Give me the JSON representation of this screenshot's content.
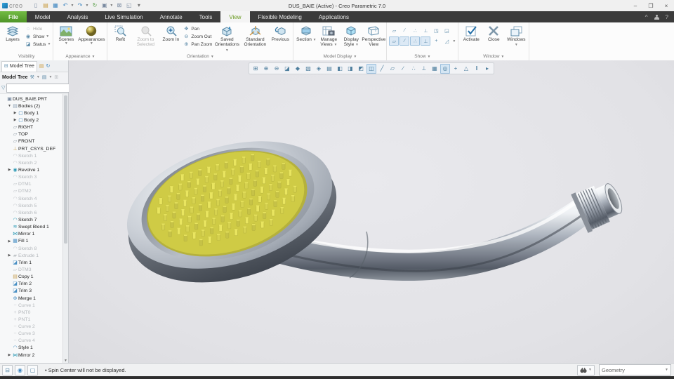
{
  "title_bar": {
    "title": "DUS_BAIE (Active) - Creo Parametric 7.0",
    "logo_word": "creo",
    "quick_access_icons": [
      "new",
      "open",
      "save",
      "undo",
      "redo",
      "regenerate",
      "window-switch",
      "close-window",
      "new-window",
      "customize"
    ],
    "window_buttons": {
      "minimize": "–",
      "maximize": "❐",
      "close": "×"
    }
  },
  "tabs": {
    "items": [
      "File",
      "Model",
      "Analysis",
      "Live Simulation",
      "Annotate",
      "Tools",
      "View",
      "Flexible Modeling",
      "Applications"
    ],
    "active": "View",
    "right_icons": [
      "collapse-ribbon",
      "user",
      "help"
    ],
    "help_glyph": "?",
    "collapse_glyph": "^"
  },
  "ribbon": {
    "visibility": {
      "layers": "Layers",
      "hide": "Hide",
      "show": "Show",
      "status": "Status",
      "label": "Visibility",
      "has_menu": false
    },
    "appearance": {
      "scenes": "Scenes",
      "appearances": "Appearances",
      "label": "Appearance",
      "has_menu": true
    },
    "orientation": {
      "refit": "Refit",
      "zoom_to_selected": "Zoom to Selected",
      "zoom_in": "Zoom In",
      "pan": "Pan",
      "zoom_out": "Zoom Out",
      "pan_zoom": "Pan Zoom",
      "saved_orientations": "Saved Orientations",
      "standard_orientation": "Standard Orientation",
      "previous": "Previous",
      "label": "Orientation",
      "has_menu": true
    },
    "model_display": {
      "section": "Section",
      "manage_views": "Manage Views",
      "display_style": "Display Style",
      "perspective_view": "Perspective View",
      "label": "Model Display",
      "has_menu": true
    },
    "show": {
      "label": "Show",
      "has_menu": true,
      "row1": [
        "plane-display",
        "axis-display",
        "point-display",
        "csys-display",
        "annotation-display",
        "model-tree-display"
      ],
      "row2": [
        "plane-tag-display",
        "axis-tag-display",
        "point-tag-display",
        "csys-tag-display",
        "spin-center",
        "datum-display-filter"
      ],
      "row2_pressed": [
        true,
        true,
        true,
        true,
        false,
        false
      ]
    },
    "window": {
      "activate": "Activate",
      "close": "Close",
      "windows": "Windows",
      "label": "Window",
      "has_menu": true
    }
  },
  "navigator": {
    "tab_label": "Model Tree",
    "tab_icons": [
      "folder-browser",
      "favorites",
      "history"
    ],
    "toolbar_label": "Model Tree",
    "toolbar_icons": [
      "tree-filters",
      "tree-columns",
      "tree-settings"
    ],
    "search": {
      "value": "",
      "placeholder": ""
    },
    "tree": [
      {
        "label": "DUS_BAIE.PRT",
        "level": 0,
        "icon": "part",
        "arrow": "none",
        "suppressed": false
      },
      {
        "label": "Bodies (2)",
        "level": 1,
        "icon": "folder",
        "arrow": "expanded",
        "suppressed": false
      },
      {
        "label": "Body 1",
        "level": 2,
        "icon": "body",
        "arrow": "collapsed",
        "suppressed": false
      },
      {
        "label": "Body 2",
        "level": 2,
        "icon": "body2",
        "arrow": "collapsed",
        "suppressed": false
      },
      {
        "label": "RIGHT",
        "level": 1,
        "icon": "plane",
        "arrow": "none",
        "suppressed": false
      },
      {
        "label": "TOP",
        "level": 1,
        "icon": "plane",
        "arrow": "none",
        "suppressed": false
      },
      {
        "label": "FRONT",
        "level": 1,
        "icon": "plane",
        "arrow": "none",
        "suppressed": false
      },
      {
        "label": "PRT_CSYS_DEF",
        "level": 1,
        "icon": "csys",
        "arrow": "none",
        "suppressed": false
      },
      {
        "label": "Sketch 1",
        "level": 1,
        "icon": "sketch",
        "arrow": "none",
        "suppressed": true
      },
      {
        "label": "Sketch 2",
        "level": 1,
        "icon": "sketch",
        "arrow": "none",
        "suppressed": true
      },
      {
        "label": "Revolve 1",
        "level": 1,
        "icon": "revolve",
        "arrow": "collapsed",
        "suppressed": false
      },
      {
        "label": "Sketch 3",
        "level": 1,
        "icon": "sketch",
        "arrow": "none",
        "suppressed": true
      },
      {
        "label": "DTM1",
        "level": 1,
        "icon": "dtm",
        "arrow": "none",
        "suppressed": true
      },
      {
        "label": "DTM2",
        "level": 1,
        "icon": "dtm",
        "arrow": "none",
        "suppressed": true
      },
      {
        "label": "Sketch 4",
        "level": 1,
        "icon": "sketch",
        "arrow": "none",
        "suppressed": true
      },
      {
        "label": "Sketch 5",
        "level": 1,
        "icon": "sketch",
        "arrow": "none",
        "suppressed": true
      },
      {
        "label": "Sketch 6",
        "level": 1,
        "icon": "sketch",
        "arrow": "none",
        "suppressed": true
      },
      {
        "label": "Sketch 7",
        "level": 1,
        "icon": "sketcha",
        "arrow": "none",
        "suppressed": false
      },
      {
        "label": "Swept Blend 1",
        "level": 1,
        "icon": "sweep",
        "arrow": "none",
        "suppressed": false
      },
      {
        "label": "Mirror 1",
        "level": 1,
        "icon": "mirror",
        "arrow": "none",
        "suppressed": false
      },
      {
        "label": "Fill 1",
        "level": 1,
        "icon": "fill",
        "arrow": "collapsed",
        "suppressed": false
      },
      {
        "label": "Sketch 8",
        "level": 1,
        "icon": "sketch",
        "arrow": "none",
        "suppressed": true
      },
      {
        "label": "Extrude 1",
        "level": 1,
        "icon": "extrude",
        "arrow": "collapsed",
        "suppressed": true
      },
      {
        "label": "Trim 1",
        "level": 1,
        "icon": "trim",
        "arrow": "none",
        "suppressed": false
      },
      {
        "label": "DTM3",
        "level": 1,
        "icon": "dtm",
        "arrow": "none",
        "suppressed": true
      },
      {
        "label": "Copy 1",
        "level": 1,
        "icon": "copy",
        "arrow": "none",
        "suppressed": false
      },
      {
        "label": "Trim 2",
        "level": 1,
        "icon": "trim",
        "arrow": "none",
        "suppressed": false
      },
      {
        "label": "Trim 3",
        "level": 1,
        "icon": "trim",
        "arrow": "none",
        "suppressed": false
      },
      {
        "label": "Merge 1",
        "level": 1,
        "icon": "merge",
        "arrow": "none",
        "suppressed": false
      },
      {
        "label": "Curve 1",
        "level": 1,
        "icon": "curve",
        "arrow": "none",
        "suppressed": true
      },
      {
        "label": "PNT0",
        "level": 1,
        "icon": "point",
        "arrow": "none",
        "suppressed": true
      },
      {
        "label": "PNT1",
        "level": 1,
        "icon": "point",
        "arrow": "none",
        "suppressed": true
      },
      {
        "label": "Curve 2",
        "level": 1,
        "icon": "curve",
        "arrow": "none",
        "suppressed": true
      },
      {
        "label": "Curve 3",
        "level": 1,
        "icon": "curve",
        "arrow": "none",
        "suppressed": true
      },
      {
        "label": "Curve 4",
        "level": 1,
        "icon": "curve",
        "arrow": "none",
        "suppressed": true
      },
      {
        "label": "Style 1",
        "level": 1,
        "icon": "style",
        "arrow": "none",
        "suppressed": false
      },
      {
        "label": "Mirror 2",
        "level": 1,
        "icon": "mirror",
        "arrow": "collapsed",
        "suppressed": false
      }
    ]
  },
  "graphics_toolbar": {
    "icons": [
      {
        "name": "refit",
        "pressed": false
      },
      {
        "name": "zoom-in",
        "pressed": false
      },
      {
        "name": "zoom-out",
        "pressed": false
      },
      {
        "name": "repaint",
        "pressed": false
      },
      {
        "name": "shading-quality",
        "pressed": false
      },
      {
        "name": "no-hidden",
        "pressed": false
      },
      {
        "name": "enhanced-realism",
        "pressed": false
      },
      {
        "name": "scene-render",
        "pressed": false
      },
      {
        "name": "wireframe",
        "pressed": false
      },
      {
        "name": "hidden-line",
        "pressed": false
      },
      {
        "name": "shading",
        "pressed": false
      },
      {
        "name": "shading-with-edges",
        "pressed": true
      },
      {
        "name": "clipping",
        "pressed": false
      },
      {
        "name": "plane-display",
        "pressed": false
      },
      {
        "name": "axis-display",
        "pressed": false
      },
      {
        "name": "point-display",
        "pressed": false
      },
      {
        "name": "csys-display",
        "pressed": false
      },
      {
        "name": "annotation-display",
        "pressed": false
      },
      {
        "name": "spin-center",
        "pressed": true
      },
      {
        "name": "3d-dragger",
        "pressed": false
      },
      {
        "name": "perspective",
        "pressed": false
      },
      {
        "name": "pause",
        "pressed": false
      },
      {
        "name": "resume",
        "pressed": false
      }
    ]
  },
  "statusbar": {
    "message": "• Spin Center will not be displayed.",
    "left_icons": [
      "navigator-toggle",
      "web-browser-toggle",
      "full-screen-toggle"
    ],
    "selector_value": "Geometry"
  },
  "model": {
    "part_name": "DUS_BAIE.PRT",
    "nozzle_color": "#d6d24f",
    "nozzle_light": "#e9e55f",
    "nozzle_dark": "#b5b13c",
    "chrome_light": "#f4f6f8",
    "chrome_mid": "#b6bcc4",
    "chrome_dark": "#5d646e",
    "viewport_background": "#e4e4e8"
  }
}
